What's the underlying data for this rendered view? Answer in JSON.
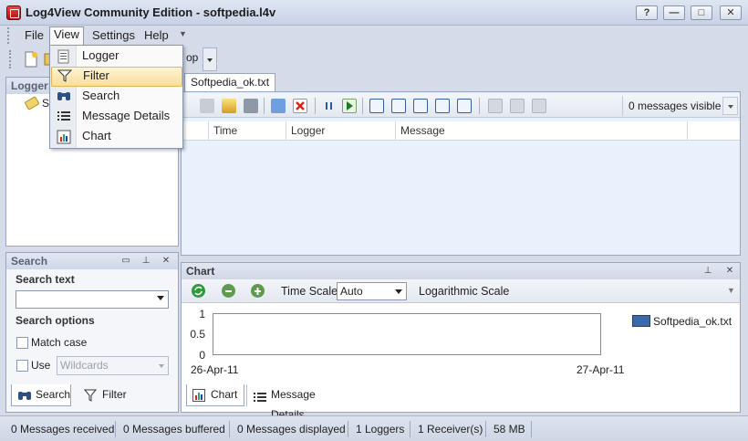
{
  "window": {
    "title": "Log4View Community Edition - softpedia.l4v",
    "controls": {
      "help": "?",
      "minimize": "—",
      "maximize": "□",
      "close": "✕"
    }
  },
  "menubar": {
    "items": [
      {
        "label": "File"
      },
      {
        "label": "View"
      },
      {
        "label": "Settings"
      },
      {
        "label": "Help"
      }
    ]
  },
  "view_menu": {
    "items": [
      {
        "label": "Logger",
        "icon": "logger-icon"
      },
      {
        "label": "Filter",
        "icon": "filter-icon",
        "highlighted": true
      },
      {
        "label": "Search",
        "icon": "binoculars-icon"
      },
      {
        "label": "Message Details",
        "icon": "list-icon"
      },
      {
        "label": "Chart",
        "icon": "bar-chart-icon"
      }
    ]
  },
  "toolbar": {
    "partial_label": "op"
  },
  "logger_pane": {
    "title": "Logger",
    "tree_root_label": "So"
  },
  "search_pane": {
    "title": "Search",
    "search_text_label": "Search text",
    "search_text_value": "",
    "search_options_label": "Search options",
    "match_case_label": "Match case",
    "match_case_checked": false,
    "use_label": "Use",
    "use_checked": false,
    "use_mode_value": "Wildcards",
    "tabs": [
      {
        "label": "Search"
      },
      {
        "label": "Filter"
      }
    ]
  },
  "log_view": {
    "tab_label": "Softpedia_ok.txt",
    "messages_visible": "0 messages visible",
    "columns": [
      "Time",
      "Logger",
      "Message"
    ]
  },
  "chart_pane": {
    "title": "Chart",
    "time_scale_label": "Time Scale",
    "time_scale_value": "Auto",
    "log_scale_label": "Logarithmic Scale",
    "tabs": [
      {
        "label": "Chart"
      },
      {
        "label": "Message Details"
      }
    ]
  },
  "chart_data": {
    "type": "bar",
    "categories": [
      "26-Apr-11",
      "27-Apr-11"
    ],
    "series": [
      {
        "name": "Softpedia_ok.txt",
        "values": [
          0,
          0
        ],
        "color": "#3a68a8"
      }
    ],
    "y_ticks": [
      "1",
      "0.5",
      "0"
    ],
    "ylim": [
      0,
      1
    ],
    "legend_position": "right"
  },
  "statusbar": {
    "messages_received": "0 Messages received",
    "messages_buffered": "0 Messages buffered",
    "messages_displayed": "0 Messages displayed",
    "loggers": "1 Loggers",
    "receivers": "1 Receiver(s)",
    "memory": "58 MB"
  },
  "colors": {
    "accent": "#3a68a8",
    "menu_highlight": "#f9dd9a",
    "grid_background": "#e9f2fc"
  }
}
